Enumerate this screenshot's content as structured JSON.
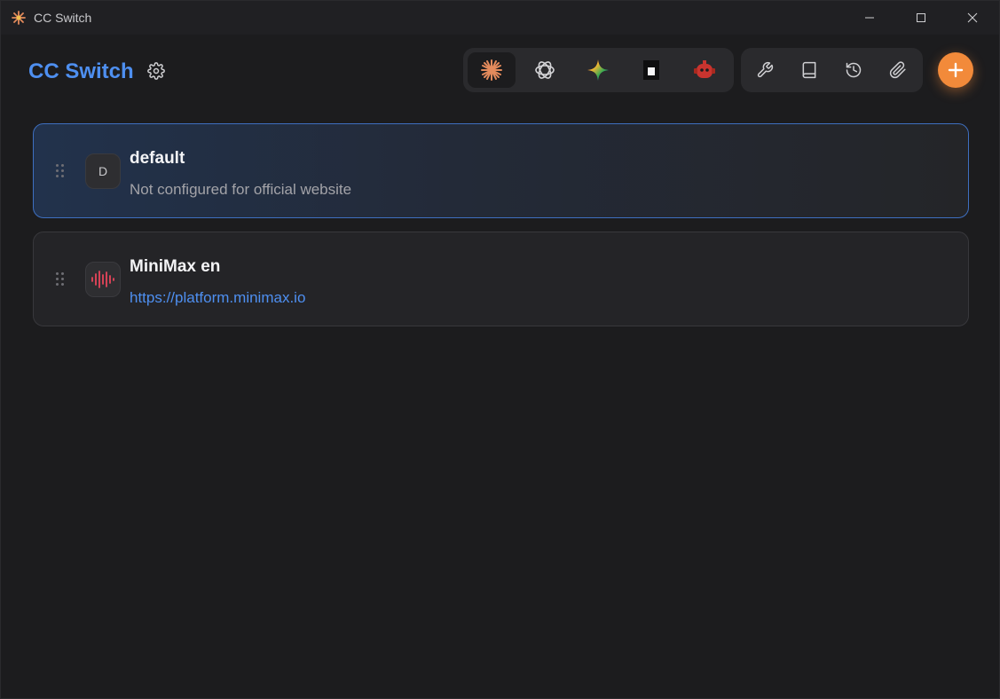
{
  "window": {
    "title": "CC Switch"
  },
  "header": {
    "brand": "CC Switch"
  },
  "app_switcher": [
    {
      "name": "claude",
      "icon": "claude-sparkle-icon",
      "active": true
    },
    {
      "name": "codex",
      "icon": "openai-knot-icon",
      "active": false
    },
    {
      "name": "gemini",
      "icon": "gemini-star-icon",
      "active": false
    },
    {
      "name": "terminal",
      "icon": "terminal-square-icon",
      "active": false
    },
    {
      "name": "robot",
      "icon": "robot-head-icon",
      "active": false
    }
  ],
  "tools": [
    {
      "name": "settings-tool",
      "icon": "wrench-icon"
    },
    {
      "name": "docs",
      "icon": "book-icon"
    },
    {
      "name": "history",
      "icon": "history-icon"
    },
    {
      "name": "attachments",
      "icon": "paperclip-icon"
    }
  ],
  "providers": [
    {
      "name": "default",
      "subtitle": "Not configured for official website",
      "avatar": "D",
      "selected": true
    },
    {
      "name": "MiniMax en",
      "subtitle": "https://platform.minimax.io",
      "avatar": "",
      "selected": false
    }
  ],
  "colors": {
    "accent": "#4e8ff0",
    "add_button": "#f28a3a",
    "claude": "#e38a5c",
    "minimax": "#e8455b"
  }
}
